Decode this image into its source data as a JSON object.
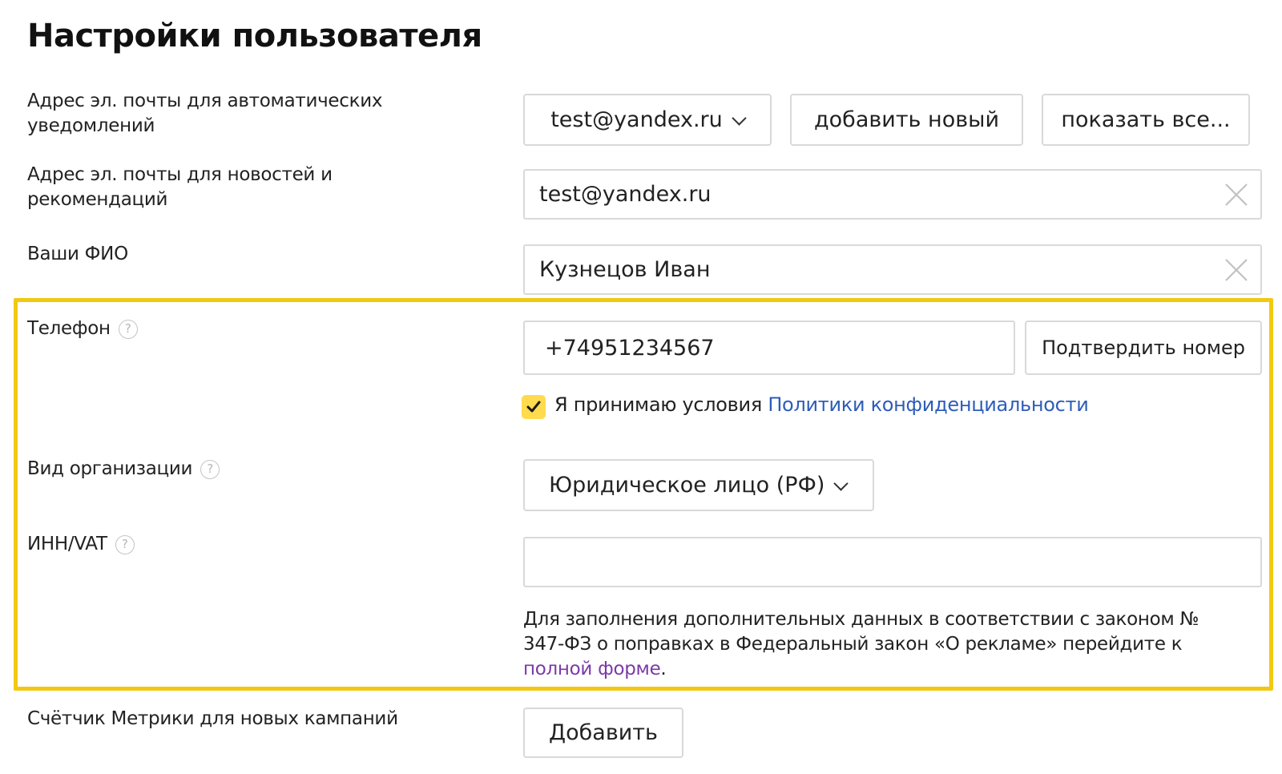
{
  "page": {
    "title": "Настройки пользователя"
  },
  "notifications_email": {
    "label": "Адрес эл. почты для автоматических уведомлений",
    "selected": "test@yandex.ru",
    "add_button": "добавить новый",
    "show_all_button": "показать все..."
  },
  "news_email": {
    "label": "Адрес эл. почты для новостей и рекомендаций",
    "value": "test@yandex.ru"
  },
  "full_name": {
    "label": "Ваши ФИО",
    "value": "Кузнецов Иван"
  },
  "phone": {
    "label": "Телефон",
    "value": "+74951234567",
    "confirm_button": "Подтвердить номер",
    "consent_checked": true,
    "consent_text": "Я принимаю условия",
    "consent_link": "Политики конфиденциальности"
  },
  "org_type": {
    "label": "Вид организации",
    "selected": "Юридическое лицо (РФ)"
  },
  "inn": {
    "label": "ИНН/VAT",
    "value": "",
    "note_line1": "Для заполнения дополнительных данных в соответствии с законом №",
    "note_line2": "347-ФЗ о поправках в Федеральный закон «О рекламе» перейдите к",
    "note_link": "полной форме",
    "note_end": "."
  },
  "metrika": {
    "label": "Счётчик Метрики для новых кампаний",
    "add_button": "Добавить"
  },
  "colors": {
    "highlight": "#f2c811",
    "checkbox": "#ffdb4d",
    "link": "#2e5db8"
  }
}
